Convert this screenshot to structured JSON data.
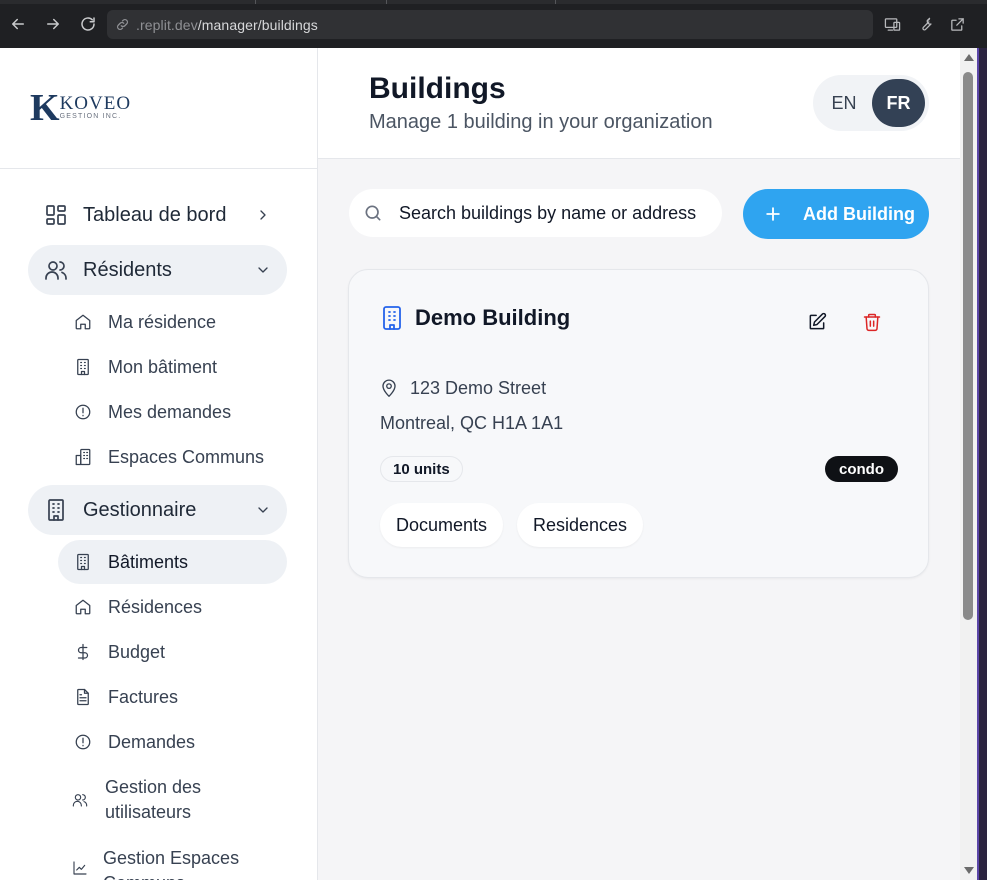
{
  "browser": {
    "url_dim": ".replit.dev",
    "url_path": "/manager/buildings"
  },
  "brand": {
    "logo_letter": "K",
    "logo_word": "KOVEO",
    "logo_sub": "GESTION INC."
  },
  "sidebar": {
    "dashboard": "Tableau de bord",
    "residents": {
      "label": "Résidents",
      "items": [
        "Ma résidence",
        "Mon bâtiment",
        "Mes demandes",
        "Espaces Communs"
      ]
    },
    "manager": {
      "label": "Gestionnaire",
      "items": [
        "Bâtiments",
        "Résidences",
        "Budget",
        "Factures",
        "Demandes",
        "Gestion des utilisateurs",
        "Gestion Espaces Communs"
      ]
    }
  },
  "header": {
    "title": "Buildings",
    "subtitle": "Manage 1 building in your organization",
    "lang_en": "EN",
    "lang_fr": "FR",
    "active_lang": "FR"
  },
  "toolbar": {
    "search_placeholder": "Search buildings by name or address",
    "add_label": "Add Building"
  },
  "buildings": [
    {
      "name": "Demo Building",
      "address_line1": "123 Demo Street",
      "address_line2": "Montreal, QC H1A 1A1",
      "units": "10 units",
      "type": "condo",
      "documents_label": "Documents",
      "residences_label": "Residences"
    }
  ],
  "colors": {
    "accent": "#2fa4f0",
    "building_icon": "#2563eb",
    "delete": "#dc2626",
    "lang_active": "#334155"
  }
}
